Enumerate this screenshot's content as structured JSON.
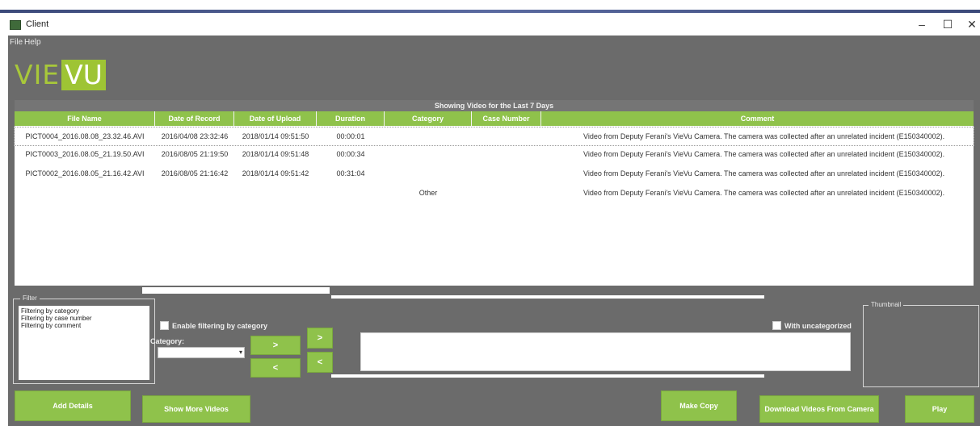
{
  "window": {
    "title": "Client",
    "controls": {
      "minimize": "–",
      "maximize": "☐",
      "close": "✕"
    }
  },
  "menu": {
    "file": "File",
    "help": "Help"
  },
  "logo": {
    "part1": "VIE",
    "part2": "VU"
  },
  "table": {
    "caption": "Showing Video for the Last 7 Days",
    "columns": [
      "File Name",
      "Date of Record",
      "Date of Upload",
      "Duration",
      "Category",
      "Case Number",
      "Comment"
    ],
    "rows": [
      {
        "file_name": "PICT0004_2016.08.08_23.32.46.AVI",
        "date_record": "2016/04/08 23:32:46",
        "date_upload": "2018/01/14 09:51:50",
        "duration": "00:00:01",
        "category": "",
        "case_number": "",
        "comment": "Video from Deputy Ferani's VieVu Camera. The camera was collected after an unrelated incident (E150340002)."
      },
      {
        "file_name": "PICT0003_2016.08.05_21.19.50.AVI",
        "date_record": "2016/08/05 21:19:50",
        "date_upload": "2018/01/14 09:51:48",
        "duration": "00:00:34",
        "category": "",
        "case_number": "",
        "comment": "Video from Deputy Ferani's VieVu Camera. The camera was collected after an unrelated incident (E150340002)."
      },
      {
        "file_name": "PICT0002_2016.08.05_21.16.42.AVI",
        "date_record": "2016/08/05 21:16:42",
        "date_upload": "2018/01/14 09:51:42",
        "duration": "00:31:04",
        "category": "",
        "case_number": "",
        "comment": "Video from Deputy Ferani's VieVu Camera. The camera was collected after an unrelated incident (E150340002)."
      },
      {
        "file_name": "",
        "date_record": "",
        "date_upload": "",
        "duration": "",
        "category": "Other",
        "case_number": "",
        "comment": "Video from Deputy Ferani's VieVu Camera. The camera was collected after an unrelated incident (E150340002)."
      }
    ]
  },
  "filter": {
    "title": "Filter",
    "items": [
      "Filtering by category",
      "Filtering by case number",
      "Filtering by comment"
    ],
    "enable_label": "Enable filtering by category",
    "category_label": "Category:",
    "category_value": "",
    "with_uncategorized_label": "With uncategorized"
  },
  "arrows": {
    "right": ">",
    "left": "<",
    "right_all": ">",
    "left_all": "<"
  },
  "thumbnail": {
    "title": "Thumbnail"
  },
  "buttons": {
    "add_details": "Add Details",
    "show_more": "Show More Videos",
    "make_copy": "Make Copy",
    "download": "Download Videos From Camera",
    "play": "Play"
  },
  "colors": {
    "accent": "#8fc24b",
    "panel": "#6b6b6b",
    "logo": "#9ec434"
  }
}
